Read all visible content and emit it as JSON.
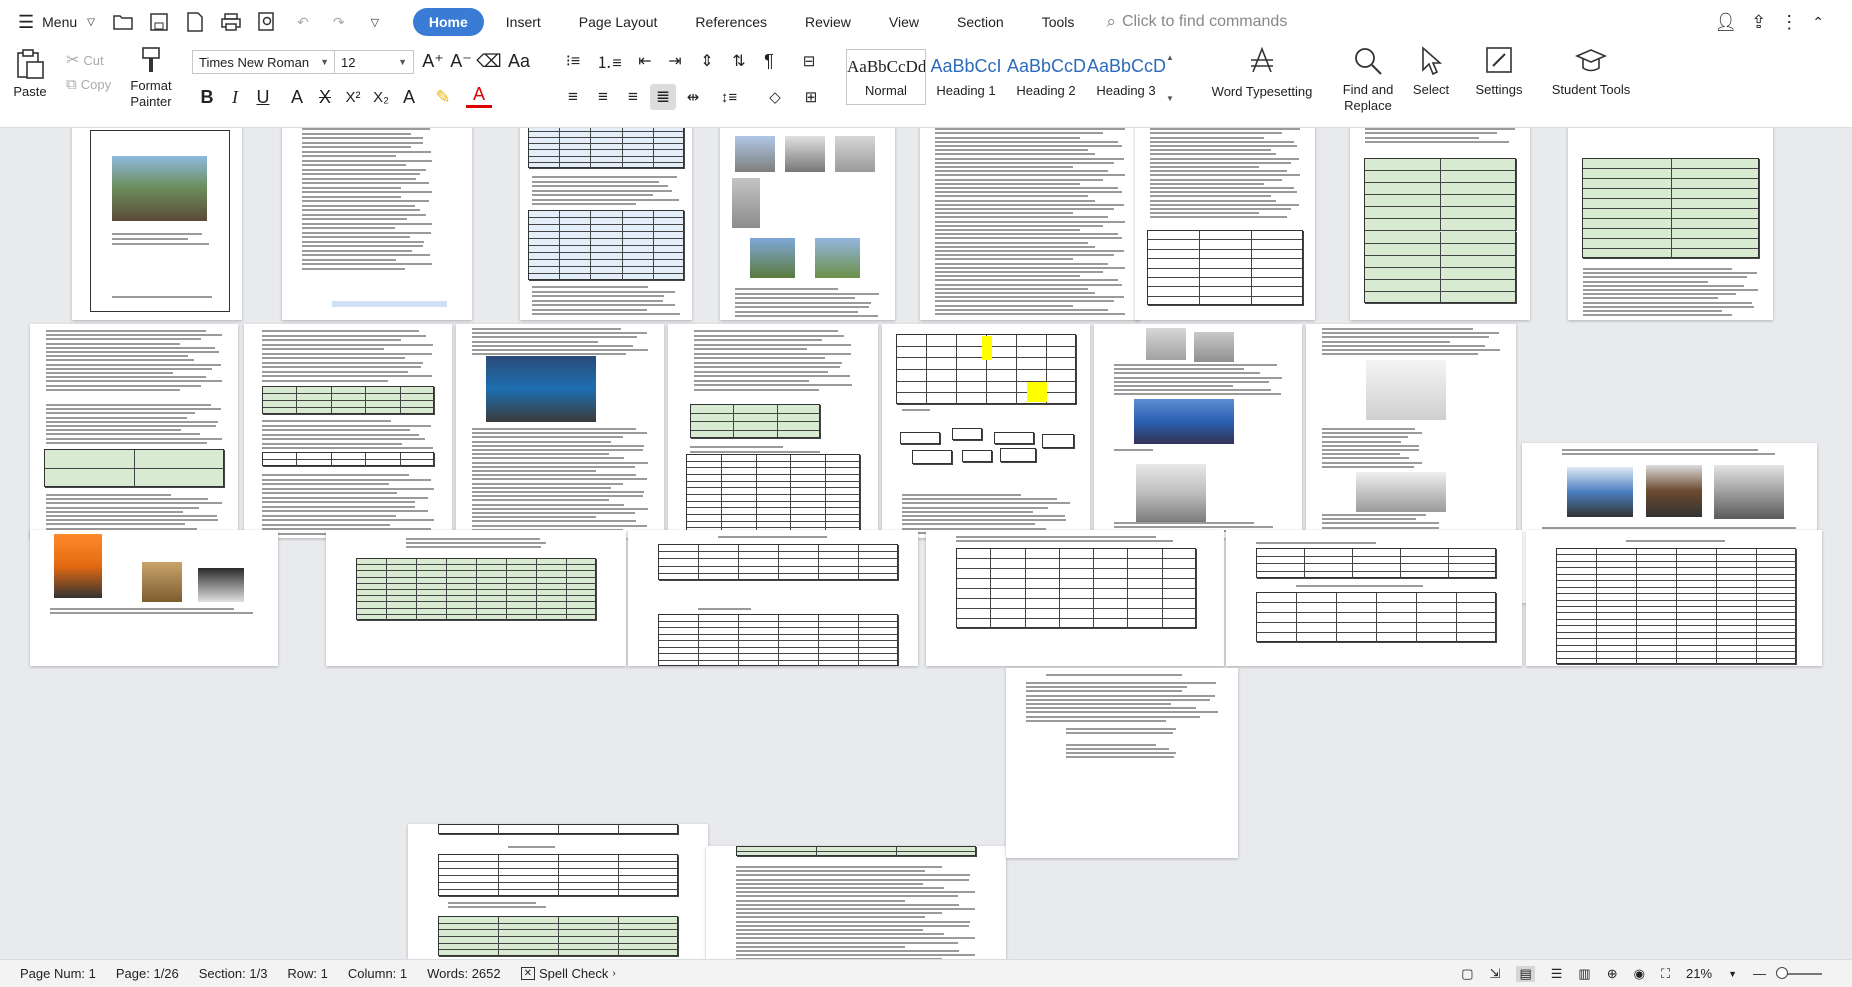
{
  "menubar": {
    "menu_label": "Menu",
    "tabs": [
      {
        "label": "Home",
        "active": true
      },
      {
        "label": "Insert"
      },
      {
        "label": "Page Layout"
      },
      {
        "label": "References"
      },
      {
        "label": "Review"
      },
      {
        "label": "View"
      },
      {
        "label": "Section"
      },
      {
        "label": "Tools"
      }
    ],
    "search_placeholder": "Click to find commands"
  },
  "ribbon": {
    "paste_label": "Paste",
    "cut_label": "Cut",
    "copy_label": "Copy",
    "format_painter_label": "Format Painter",
    "font_name": "Times New Roman",
    "font_size": "12",
    "styles": [
      {
        "preview": "AaBbCcDd",
        "label": "Normal"
      },
      {
        "preview": "AaBbCcI",
        "label": "Heading 1"
      },
      {
        "preview": "AaBbCcD",
        "label": "Heading 2"
      },
      {
        "preview": "AaBbCcD",
        "label": "Heading 3"
      }
    ],
    "word_typesetting_label": "Word Typesetting",
    "find_replace_label": "Find and Replace",
    "select_label": "Select",
    "settings_label": "Settings",
    "student_tools_label": "Student Tools"
  },
  "statusbar": {
    "page_num": "Page Num: 1",
    "page": "Page: 1/26",
    "section": "Section: 1/3",
    "row": "Row: 1",
    "column": "Column: 1",
    "words": "Words: 2652",
    "spell_check": "Spell Check",
    "zoom": "21%"
  },
  "colors": {
    "accent": "#3a7bd5",
    "table_green": "#d9ead3",
    "highlight_yellow": "#ffff00"
  }
}
